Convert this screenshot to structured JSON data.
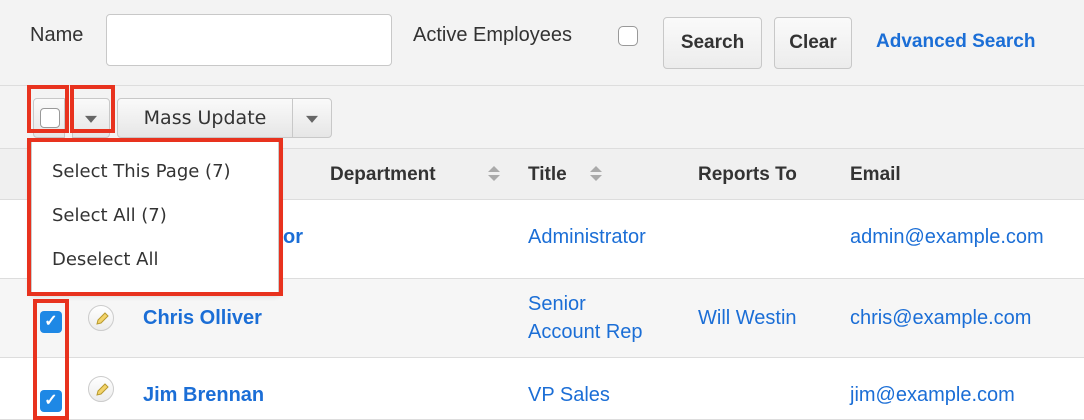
{
  "search": {
    "name_label": "Name",
    "name_value": "",
    "active_label": "Active Employees",
    "active_checked": false,
    "search_button": "Search",
    "clear_button": "Clear",
    "advanced_link": "Advanced Search"
  },
  "toolbar": {
    "mass_update_label": "Mass Update"
  },
  "select_menu": {
    "items": [
      "Select This Page (7)",
      "Select All (7)",
      "Deselect All"
    ]
  },
  "table": {
    "columns": [
      "Department",
      "Title",
      "Reports To",
      "Email"
    ],
    "rows": [
      {
        "name_fragment": "or",
        "title": "Administrator",
        "reports_to": "",
        "email": "admin@example.com",
        "checked": false
      },
      {
        "name": "Chris Olliver",
        "title_line1": "Senior",
        "title_line2": "Account Rep",
        "reports_to": "Will Westin",
        "email": "chris@example.com",
        "checked": true
      },
      {
        "name": "Jim Brennan",
        "title": "VP Sales",
        "reports_to": "",
        "email": "jim@example.com",
        "checked": true
      }
    ]
  },
  "colors": {
    "link": "#1b6ed6",
    "highlight": "#e8321e",
    "checkbox_checked": "#1e88e5"
  }
}
